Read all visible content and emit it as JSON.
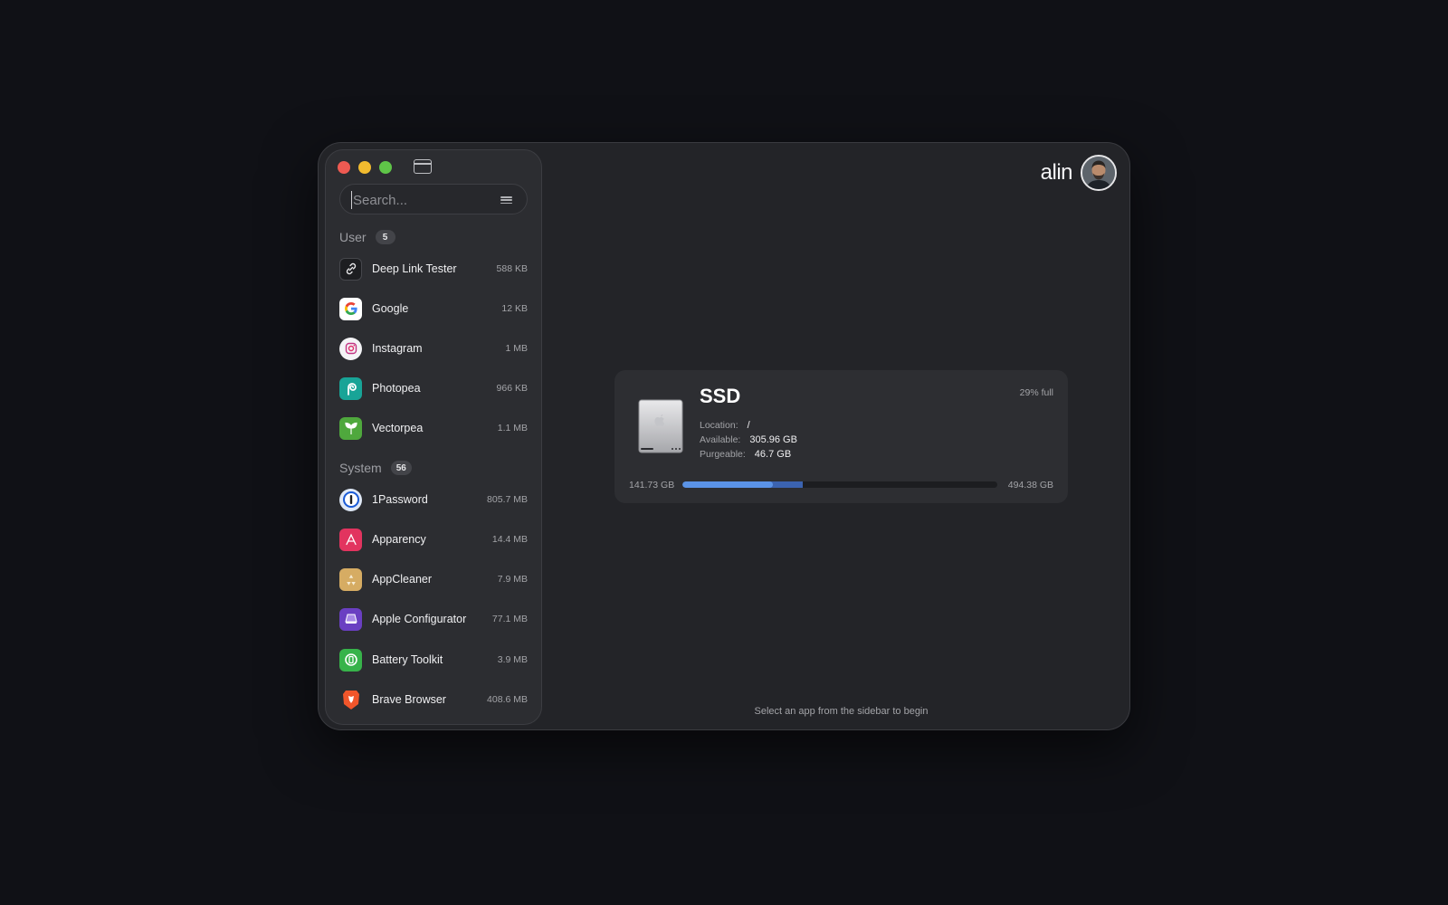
{
  "sidebar": {
    "search": {
      "placeholder": "Search..."
    },
    "sections": {
      "user": {
        "title": "User",
        "count": "5",
        "apps": [
          {
            "name": "Deep Link Tester",
            "size": "588 KB",
            "icon": "link-icon"
          },
          {
            "name": "Google",
            "size": "12 KB",
            "icon": "google-icon"
          },
          {
            "name": "Instagram",
            "size": "1 MB",
            "icon": "instagram-icon"
          },
          {
            "name": "Photopea",
            "size": "966 KB",
            "icon": "photopea-icon"
          },
          {
            "name": "Vectorpea",
            "size": "1.1 MB",
            "icon": "vectorpea-icon"
          }
        ]
      },
      "system": {
        "title": "System",
        "count": "56",
        "apps": [
          {
            "name": "1Password",
            "size": "805.7 MB",
            "icon": "1password-icon"
          },
          {
            "name": "Apparency",
            "size": "14.4 MB",
            "icon": "apparency-icon"
          },
          {
            "name": "AppCleaner",
            "size": "7.9 MB",
            "icon": "appcleaner-icon"
          },
          {
            "name": "Apple Configurator",
            "size": "77.1 MB",
            "icon": "apple-configurator-icon"
          },
          {
            "name": "Battery Toolkit",
            "size": "3.9 MB",
            "icon": "battery-toolkit-icon"
          },
          {
            "name": "Brave Browser",
            "size": "408.6 MB",
            "icon": "brave-icon"
          }
        ]
      }
    }
  },
  "user": {
    "name": "alin"
  },
  "disk": {
    "title": "SSD",
    "fill_label": "29% full",
    "location_label": "Location:",
    "location": "/",
    "available_label": "Available:",
    "available": "305.96 GB",
    "purgeable_label": "Purgeable:",
    "purgeable": "46.7 GB",
    "used": "141.73 GB",
    "total": "494.38 GB",
    "used_fraction": 0.287,
    "purgeable_fraction": 0.094
  },
  "main": {
    "hint": "Select an app from the sidebar to begin"
  },
  "colors": {
    "accent": "#5b93e6",
    "purgeable": "#3b63b0",
    "close": "#ee5a52",
    "minimize": "#f2bb2f",
    "zoom": "#5fc548"
  }
}
